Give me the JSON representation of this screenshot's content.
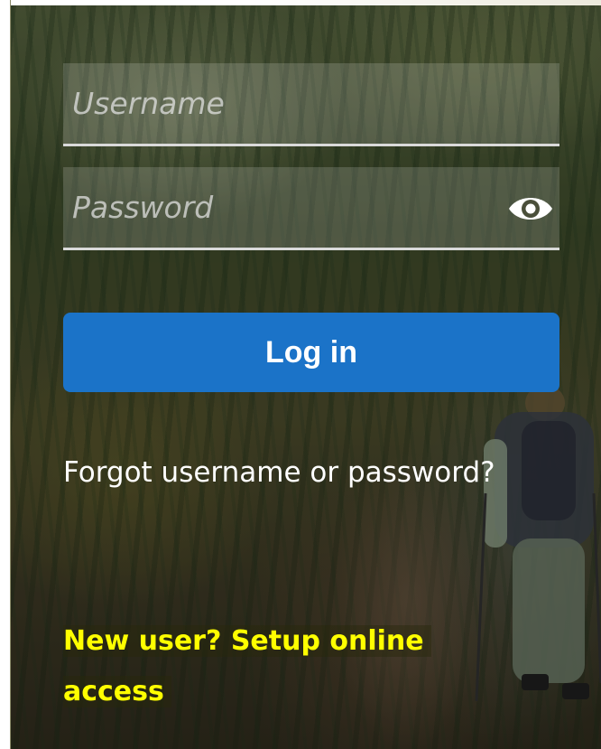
{
  "login": {
    "username_placeholder": "Username",
    "password_placeholder": "Password",
    "login_button": "Log in",
    "forgot_link": "Forgot username or password?",
    "new_user_link": "New user? Setup online access"
  },
  "icons": {
    "password_toggle": "eye-icon"
  },
  "colors": {
    "button": "#1b73c8",
    "new_user_link": "#ffff00"
  }
}
